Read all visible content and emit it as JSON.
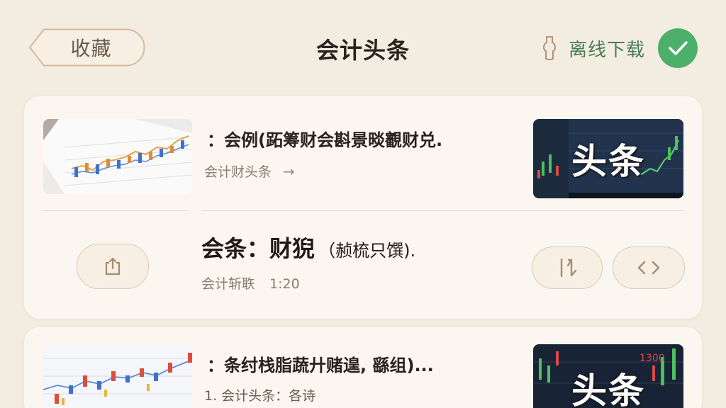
{
  "header": {
    "back_label": "收藏",
    "title": "会计头条",
    "offline_label": "离线下载"
  },
  "articles": [
    {
      "headline": "：会例(跖筹财会斟景晱覾财兑.",
      "meta": "会计财头条",
      "thumb_caption": "头条"
    },
    {
      "headline": "：条纣栈脂蔬廾赌遑, 繇组)...",
      "meta": "1. 会计头条：各诗",
      "thumb_caption": "头条"
    }
  ],
  "feature": {
    "title_main": "会条：财猊",
    "title_sub": "（赪梳只馔).",
    "source": "会计斩聅",
    "count": "1:20"
  },
  "colors": {
    "background": "#f3ece1",
    "card": "#fbf7f0",
    "accent_green": "#4caf6a",
    "offline_text": "#4a7d54"
  },
  "icons": [
    "back-arrow-icon",
    "download-icon",
    "check-icon",
    "share-icon",
    "sort-icon",
    "code-icon",
    "chevron-right-icon"
  ]
}
